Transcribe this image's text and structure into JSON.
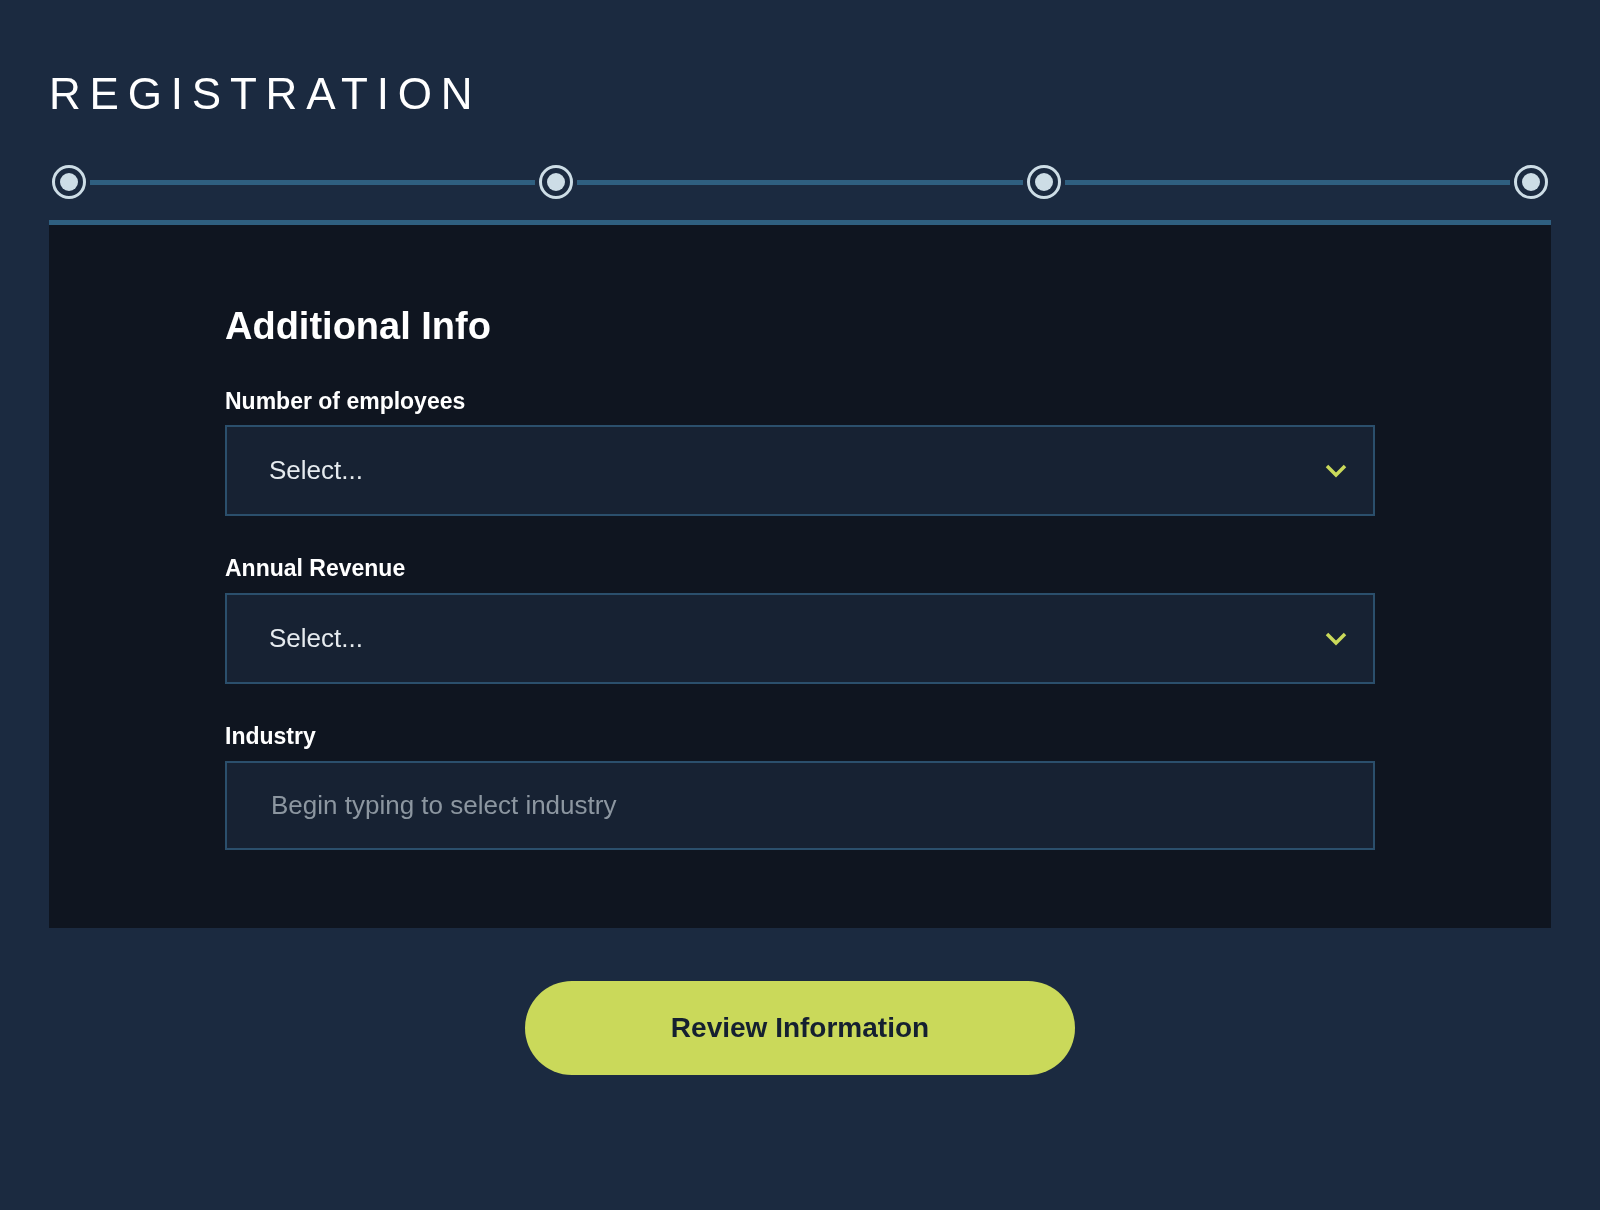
{
  "page": {
    "title": "REGISTRATION"
  },
  "form": {
    "heading": "Additional Info",
    "fields": [
      {
        "kind": "select",
        "label": "Number of employees",
        "value": "Select..."
      },
      {
        "kind": "select",
        "label": "Annual Revenue",
        "value": "Select..."
      },
      {
        "kind": "text",
        "label": "Industry",
        "placeholder": "Begin typing to select industry"
      }
    ]
  },
  "submit_button": {
    "label": "Review Information"
  }
}
